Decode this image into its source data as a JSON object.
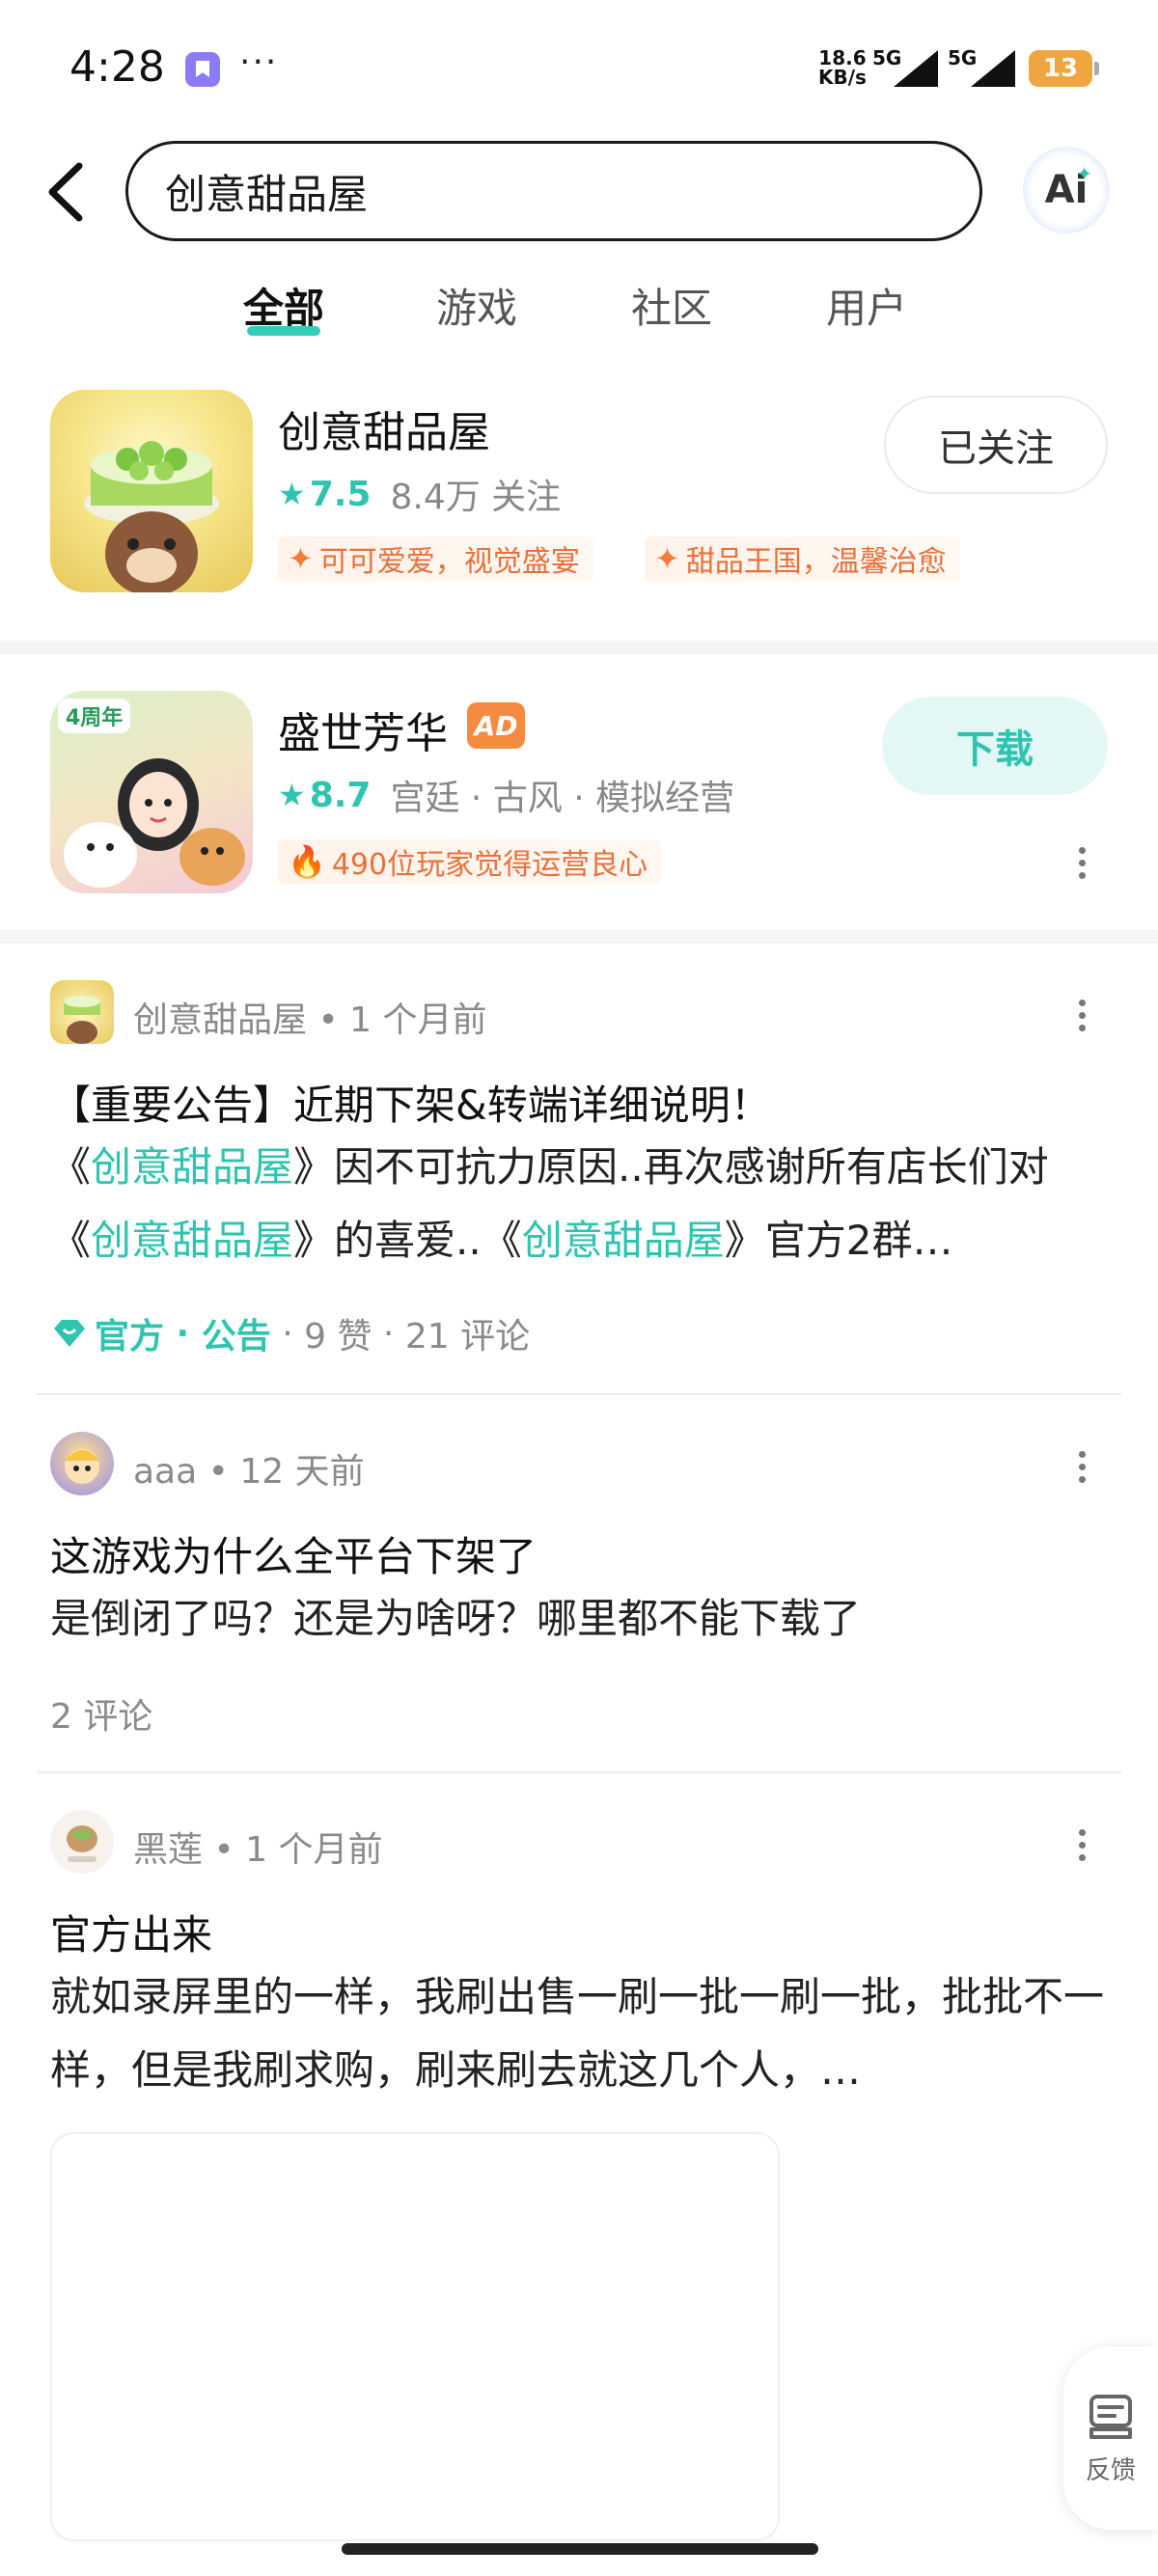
{
  "status_bar": {
    "time": "4:28",
    "dots": "···",
    "net_speed": "18.6",
    "net_unit": "KB/s",
    "sim1": "5G",
    "sim2": "5G",
    "battery": "13"
  },
  "search": {
    "query": "创意甜品屋",
    "ai_label": "Ai"
  },
  "tabs": [
    {
      "label": "全部",
      "active": true
    },
    {
      "label": "游戏",
      "active": false
    },
    {
      "label": "社区",
      "active": false
    },
    {
      "label": "用户",
      "active": false
    }
  ],
  "results": [
    {
      "title": "创意甜品屋",
      "rating": "7.5",
      "followers": "8.4万 关注",
      "tags": [
        "可可爱爱，视觉盛宴",
        "甜品王国，温馨治愈"
      ],
      "action": "已关注"
    },
    {
      "title": "盛世芳华",
      "ad_badge": "AD",
      "icon_badge": "4周年",
      "rating": "8.7",
      "genres": "宫廷 · 古风 · 模拟经营",
      "highlight": "490位玩家觉得运营良心",
      "action": "下载"
    }
  ],
  "posts": [
    {
      "author": "创意甜品屋",
      "time": "1 个月前",
      "title": "【重要公告】近期下架&转端详细说明！",
      "body_parts": {
        "p1": "《",
        "link1": "创意甜品屋",
        "p2": "》因不可抗力原因..再次感谢所有店长们对《",
        "link2": "创意甜品屋",
        "p3": "》的喜爱..《",
        "link3": "创意甜品屋",
        "p4": "》官方2群…"
      },
      "tag_official": "官方",
      "tag_notice": "公告",
      "likes": "9 赞",
      "comments": "21 评论"
    },
    {
      "author": "aaa",
      "time": "12 天前",
      "title": "这游戏为什么全平台下架了",
      "body": "是倒闭了吗？还是为啥呀？哪里都不能下载了",
      "comments": "2 评论"
    },
    {
      "author": "黑莲",
      "time": "1 个月前",
      "title": "官方出来",
      "body": "就如录屏里的一样，我刷出售一刷一批一刷一批，批批不一样，但是我刷求购，刷来刷去就这几个人，…"
    }
  ],
  "feedback_label": "反馈",
  "colors": {
    "accent": "#2ec4b0",
    "tag_orange": "#e9703a",
    "ad_orange": "#f58a40"
  }
}
